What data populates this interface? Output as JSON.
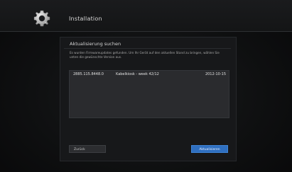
{
  "header": {
    "title": "Installation",
    "icon": "gear-icon"
  },
  "dialog": {
    "title": "Aktualisierung suchen",
    "description": "Es wurden Firmwareupdates gefunden. Um Ihr Gerät auf den aktuellen Stand zu bringen, wählen Sie unten die gewünschte Version aus.",
    "updates": [
      {
        "version": "2885.115.8448.0",
        "name": "Kabelkiosk - week 42/12",
        "date": "2012-10-15"
      }
    ],
    "buttons": {
      "back": "Zurück",
      "install": "Aktualisieren"
    }
  },
  "colors": {
    "background": "#0b0b0c",
    "panel": "#17181a",
    "list": "#2a2b2e",
    "accent": "#2f6fc0"
  }
}
